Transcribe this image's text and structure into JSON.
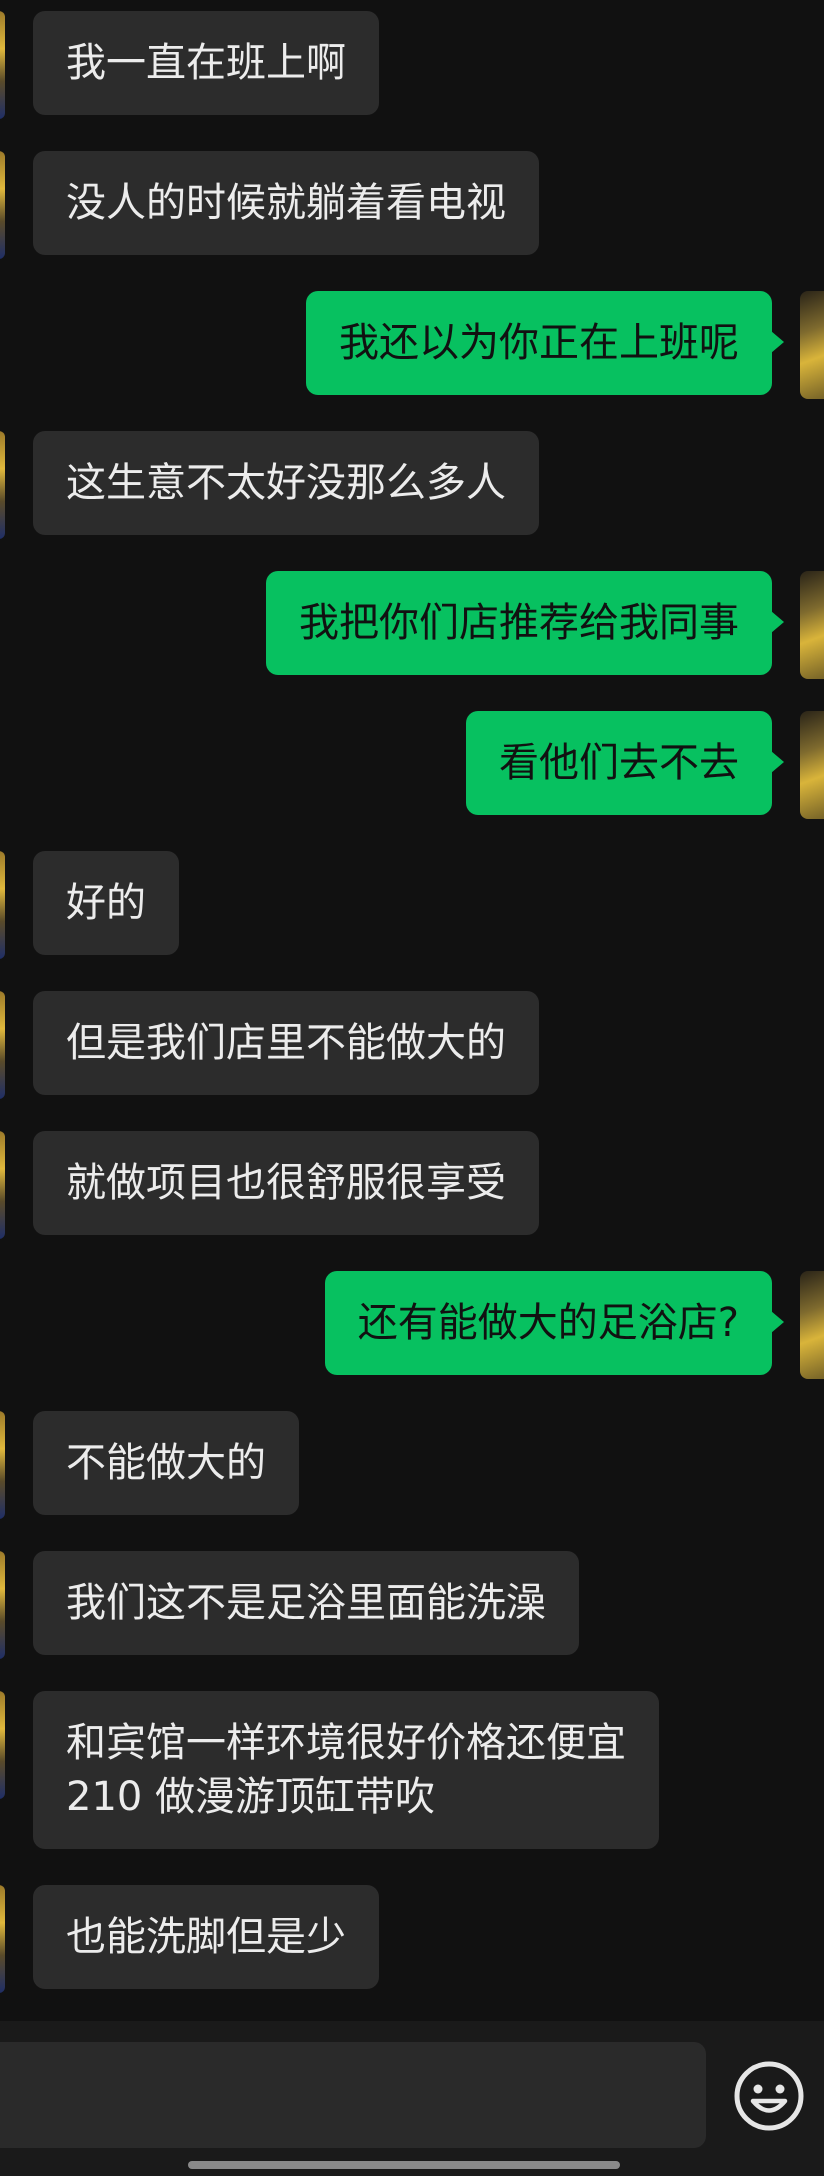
{
  "messages": [
    {
      "side": "in",
      "text": "我一直在班上啊"
    },
    {
      "side": "in",
      "text": "没人的时候就躺着看电视"
    },
    {
      "side": "out",
      "text": "我还以为你正在上班呢"
    },
    {
      "side": "in",
      "text": "这生意不太好没那么多人"
    },
    {
      "side": "out",
      "text": "我把你们店推荐给我同事"
    },
    {
      "side": "out",
      "text": "看他们去不去"
    },
    {
      "side": "in",
      "text": "好的"
    },
    {
      "side": "in",
      "text": "但是我们店里不能做大的"
    },
    {
      "side": "in",
      "text": "就做项目也很舒服很享受"
    },
    {
      "side": "out",
      "text": "还有能做大的足浴店?"
    },
    {
      "side": "in",
      "text": "不能做大的"
    },
    {
      "side": "in",
      "text": "我们这不是足浴里面能洗澡"
    },
    {
      "side": "in",
      "lines": [
        "和宾馆一样环境很好价格还便宜",
        "210 做漫游顶缸带吹"
      ]
    },
    {
      "side": "in",
      "text": "也能洗脚但是少"
    }
  ],
  "input_bar": {
    "value": "",
    "emoji_icon": "emoji-smiley-icon"
  },
  "colors": {
    "background": "#111111",
    "incoming_bubble": "#2C2C2C",
    "outgoing_bubble": "#07C160",
    "incoming_text": "#ECECEC",
    "outgoing_text": "#111111"
  }
}
